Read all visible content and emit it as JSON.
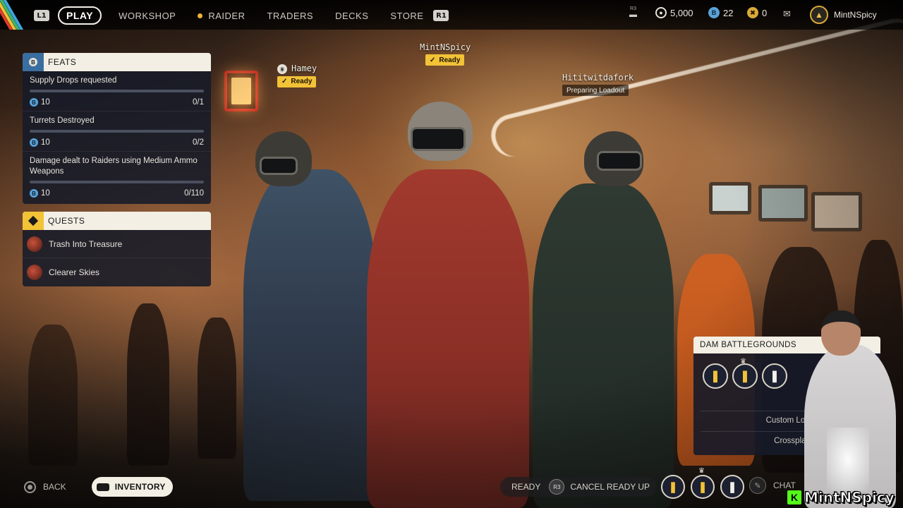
{
  "nav": {
    "l1": "L1",
    "r1": "R1",
    "items": [
      {
        "label": "PLAY",
        "active": true
      },
      {
        "label": "WORKSHOP"
      },
      {
        "label": "RAIDER"
      },
      {
        "label": "TRADERS"
      },
      {
        "label": "DECKS"
      },
      {
        "label": "STORE"
      }
    ]
  },
  "header": {
    "r3": "R3",
    "coins": "5,000",
    "tokens": "22",
    "stars": "0",
    "username": "MintNSpicy"
  },
  "feats": {
    "title": "FEATS",
    "items": [
      {
        "name": "Supply Drops requested",
        "reward": "10",
        "progress": "0/1",
        "fraction": 0
      },
      {
        "name": "Turrets Destroyed",
        "reward": "10",
        "progress": "0/2",
        "fraction": 0
      },
      {
        "name": "Damage dealt to Raiders using Medium Ammo Weapons",
        "reward": "10",
        "progress": "0/110",
        "fraction": 0
      }
    ]
  },
  "quests": {
    "title": "QUESTS",
    "items": [
      {
        "name": "Trash Into Treasure"
      },
      {
        "name": "Clearer Skies"
      }
    ]
  },
  "players": [
    {
      "name": "Hamey",
      "status": "Ready"
    },
    {
      "name": "MintNSpicy",
      "status": "Ready"
    },
    {
      "name": "Hititwitdafork",
      "status": "Preparing Loadout"
    }
  ],
  "dam": {
    "title": "DAM BATTLEGROUNDS",
    "custom_loadout": "Custom Loadout",
    "crossplay": "Crossplay: On"
  },
  "bottom": {
    "back": "BACK",
    "inventory": "INVENTORY",
    "ready": "READY",
    "r3": "R3",
    "cancel": "CANCEL READY UP",
    "chat": "CHAT"
  },
  "streamer": {
    "name": "MintNSpicy"
  },
  "colors": {
    "accent_yellow": "#f2c237",
    "panel_header": "#f3efe4",
    "panel_bg": "#161a28"
  }
}
